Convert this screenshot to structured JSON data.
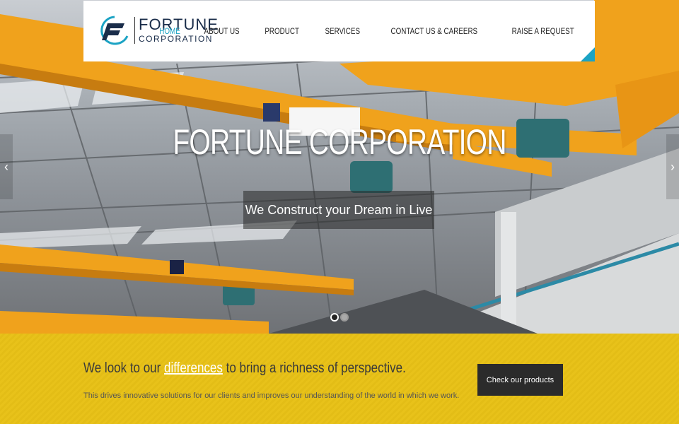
{
  "brand": {
    "name": "FORTUNE",
    "sub": "CORPORATION"
  },
  "nav": [
    {
      "label": "HOME"
    },
    {
      "label": "ABOUT US"
    },
    {
      "label": "PRODUCT"
    },
    {
      "label": "SERVICES"
    },
    {
      "label": "CONTACT US & CAREERS"
    },
    {
      "label": "RAISE A REQUEST"
    }
  ],
  "hero": {
    "title": "FORTUNE CORPORATION",
    "subtitle": "We Construct your Dream in Live",
    "prev_icon": "chevron-left-icon",
    "next_icon": "chevron-right-icon",
    "slides": 2,
    "active_slide": 1
  },
  "band": {
    "head_before": "We look to our",
    "head_link": "differences",
    "head_after": "to bring a richness of perspective.",
    "text": "This drives innovative solutions for our clients and improves our understanding of the world in which we work.",
    "cta": "Check our products"
  },
  "colors": {
    "accent": "#1ba3c4",
    "band": "#e8c21a",
    "crane": "#f0a21c",
    "dark": "#2b2b2b"
  }
}
